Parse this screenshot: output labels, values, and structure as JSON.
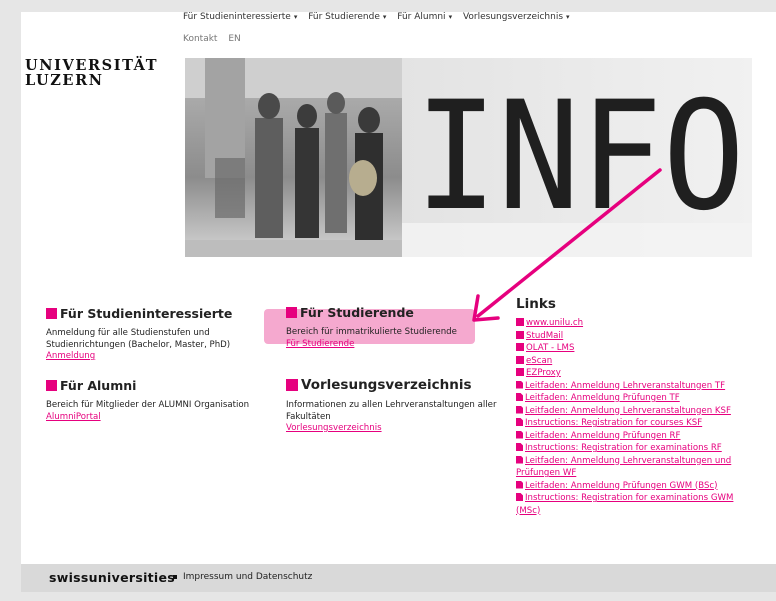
{
  "nav": {
    "items": [
      {
        "label": "Für Studieninteressierte"
      },
      {
        "label": "Für Studierende"
      },
      {
        "label": "Für Alumni"
      },
      {
        "label": "Vorlesungsverzeichnis"
      }
    ],
    "caret": "▾",
    "sub": {
      "contact": "Kontakt",
      "lang": "EN"
    }
  },
  "logo": {
    "line1": "UNIVERSITÄT",
    "line2": "LUZERN"
  },
  "hero": {
    "text": "INFO"
  },
  "sections": {
    "interessierte": {
      "title": "Für Studieninteressierte",
      "desc": "Anmeldung für alle Studienstufen und Studienrichtungen (Bachelor, Master, PhD)",
      "link": "Anmeldung"
    },
    "alumni": {
      "title": "Für Alumni",
      "desc": "Bereich für Mitglieder der ALUMNI Organisation",
      "link": "AlumniPortal"
    },
    "studierende": {
      "title": "Für Studierende",
      "desc": "Bereich für immatrikulierte Studierende",
      "link": "Für Studierende"
    },
    "vv": {
      "title": "Vorlesungsverzeichnis",
      "desc": "Informationen zu allen Lehrveranstaltungen aller Fakultäten",
      "link": "Vorlesungsverzeichnis"
    }
  },
  "links": {
    "title": "Links",
    "items": [
      {
        "label": "www.unilu.ch",
        "icon": "external-link-icon"
      },
      {
        "label": "StudMail",
        "icon": "external-link-icon"
      },
      {
        "label": "OLAT - LMS",
        "icon": "external-link-icon"
      },
      {
        "label": "eScan",
        "icon": "external-link-icon"
      },
      {
        "label": "EZProxy",
        "icon": "external-link-icon"
      },
      {
        "label": "Leitfaden: Anmeldung Lehrveranstaltungen TF",
        "icon": "pdf-icon"
      },
      {
        "label": "Leitfaden: Anmeldung Prüfungen TF",
        "icon": "pdf-icon"
      },
      {
        "label": "Leitfaden: Anmeldung Lehrveranstaltungen KSF",
        "icon": "pdf-icon"
      },
      {
        "label": "Instructions: Registration for courses KSF",
        "icon": "pdf-icon"
      },
      {
        "label": "Leitfaden: Anmeldung Prüfungen RF",
        "icon": "pdf-icon"
      },
      {
        "label": "Instructions: Registration for examinations RF",
        "icon": "pdf-icon"
      },
      {
        "label": "Leitfaden: Anmeldung Lehrveranstaltungen und Prüfungen WF",
        "icon": "pdf-icon"
      },
      {
        "label": "Leitfaden: Anmeldung Prüfungen GWM (BSc)",
        "icon": "pdf-icon"
      },
      {
        "label": "Instructions: Registration for examinations GWM (MSc)",
        "icon": "pdf-icon"
      }
    ]
  },
  "footer": {
    "brand": "swissuniversities",
    "impressum": "Impressum und Datenschutz"
  },
  "colors": {
    "accent": "#e6007e",
    "highlight": "#f5a9cf",
    "footer": "#d9d9d9"
  }
}
